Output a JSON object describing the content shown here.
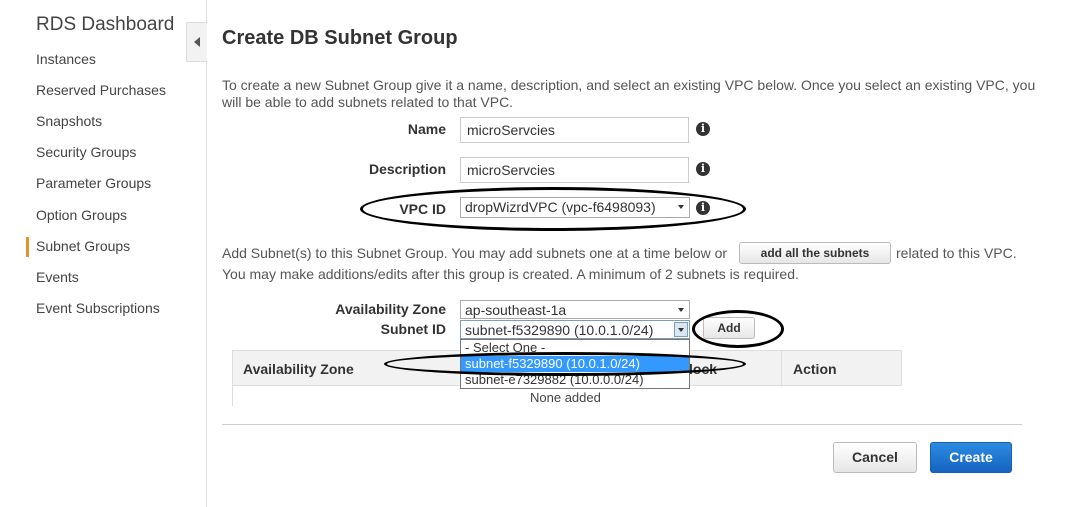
{
  "sidebar": {
    "title": "RDS Dashboard",
    "items": [
      {
        "label": "Instances"
      },
      {
        "label": "Reserved Purchases"
      },
      {
        "label": "Snapshots"
      },
      {
        "label": "Security Groups"
      },
      {
        "label": "Parameter Groups"
      },
      {
        "label": "Option Groups"
      },
      {
        "label": "Subnet Groups"
      },
      {
        "label": "Events"
      },
      {
        "label": "Event Subscriptions"
      }
    ],
    "active": "Subnet Groups"
  },
  "page": {
    "title": "Create DB Subnet Group",
    "intro": "To create a new Subnet Group give it a name, description, and select an existing VPC below. Once you select an existing VPC, you will be able to add subnets related to that VPC."
  },
  "form": {
    "name_label": "Name",
    "name_value": "microServcies",
    "description_label": "Description",
    "description_value": "microServcies",
    "vpc_label": "VPC ID",
    "vpc_value": "dropWizrdVPC (vpc-f6498093)"
  },
  "subnets": {
    "text1_before": "Add Subnet(s) to this Subnet Group. You may add subnets one at a time below or",
    "add_all_label": "add all the subnets",
    "text1_after": "related to this VPC.",
    "text2": "You may make additions/edits after this group is created. A minimum of 2 subnets is required.",
    "az_label": "Availability Zone",
    "az_value": "ap-southeast-1a",
    "subnet_label": "Subnet ID",
    "subnet_value": "subnet-f5329890 (10.0.1.0/24)",
    "add_label": "Add",
    "dropdown_options": [
      "- Select One -",
      "subnet-f5329890 (10.0.1.0/24)",
      "subnet-e7329882 (10.0.0.0/24)"
    ],
    "highlighted_option": "subnet-f5329890 (10.0.1.0/24)"
  },
  "table": {
    "col_az": "Availability Zone",
    "col_block_fragment": "lock",
    "col_action": "Action",
    "empty_text": "None added"
  },
  "footer": {
    "cancel_label": "Cancel",
    "create_label": "Create"
  },
  "icons": {
    "info": "info-icon",
    "collapse": "collapse-left-icon",
    "dropdown": "chevron-down-icon"
  },
  "colors": {
    "primary_button": "#1a6fd1",
    "active_nav_bar": "#e7912c",
    "highlight": "#3399ff"
  }
}
